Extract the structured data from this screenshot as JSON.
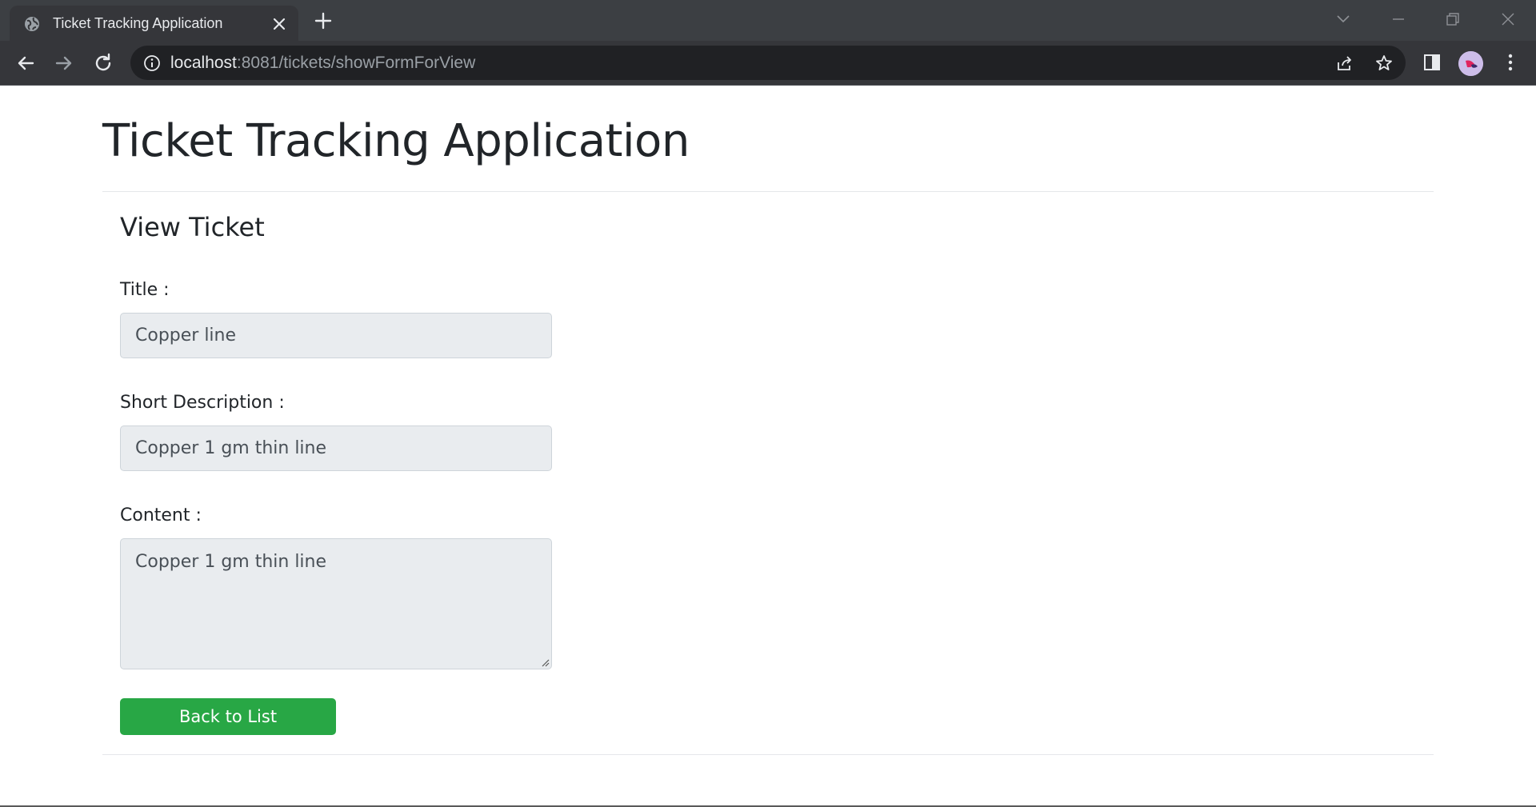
{
  "browser": {
    "tab_title": "Ticket Tracking Application",
    "url_host": "localhost",
    "url_rest": ":8081/tickets/showFormForView",
    "tab_icon": "globe-icon",
    "colors": {
      "frame": "#3c3f43",
      "toolbar": "#35363a",
      "omnibox": "#202124"
    }
  },
  "page": {
    "app_title": "Ticket Tracking Application",
    "section_title": "View Ticket",
    "fields": {
      "title": {
        "label": "Title :",
        "value": "Copper line"
      },
      "short_description": {
        "label": "Short Description :",
        "value": "Copper 1 gm thin line"
      },
      "content": {
        "label": "Content :",
        "value": "Copper 1 gm thin line"
      }
    },
    "back_button_label": "Back to List",
    "colors": {
      "button": "#28a745",
      "field_bg": "#e9ecef",
      "text": "#212529"
    }
  }
}
